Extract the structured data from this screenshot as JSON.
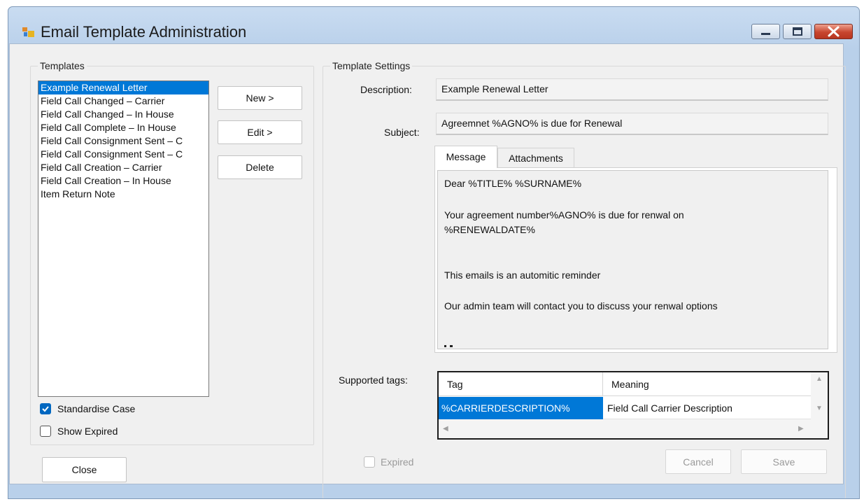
{
  "window": {
    "title": "Email Template Administration",
    "controls": {
      "minimize": "minimize-icon",
      "maximize": "maximize-icon",
      "close": "close-icon"
    }
  },
  "templates": {
    "legend": "Templates",
    "items": [
      "Example Renewal Letter",
      "Field Call Changed – Carrier",
      "Field Call Changed – In House",
      "Field Call Complete – In House",
      "Field Call Consignment Sent – C",
      "Field Call Consignment Sent – C",
      "Field Call Creation – Carrier",
      "Field Call Creation – In House",
      "Item Return Note"
    ],
    "selected_index": 0,
    "buttons": {
      "new": "New >",
      "edit": "Edit >",
      "delete": "Delete"
    },
    "standardise_case": {
      "label": "Standardise Case",
      "checked": true
    },
    "show_expired": {
      "label": "Show Expired",
      "checked": false
    }
  },
  "close_button": "Close",
  "settings": {
    "legend": "Template Settings",
    "description_label": "Description:",
    "description_value": "Example Renewal Letter",
    "subject_label": "Subject:",
    "subject_value": "Agreemnet %AGNO% is due for Renewal",
    "tabs": {
      "message": "Message",
      "attachments": "Attachments"
    },
    "message_lines": [
      "Dear %TITLE% %SURNAME%",
      "Your agreement number%AGNO%  is due for renwal on",
      "%RENEWALDATE%",
      "This emails is an automitic reminder",
      "Our admin team will contact you to discuss your renwal options"
    ],
    "supported_tags_label": "Supported tags:",
    "grid": {
      "headers": {
        "tag": "Tag",
        "meaning": "Meaning"
      },
      "rows": [
        {
          "tag": "%CARRIERDESCRIPTION%",
          "meaning": "Field Call Carrier Description"
        }
      ]
    },
    "expired": {
      "label": "Expired",
      "checked": false,
      "enabled": false
    },
    "buttons": {
      "cancel": "Cancel",
      "save": "Save"
    }
  },
  "colors": {
    "selection": "#0078d7",
    "checkbox_checked": "#0067c0",
    "frame": "#b9d0ea"
  }
}
